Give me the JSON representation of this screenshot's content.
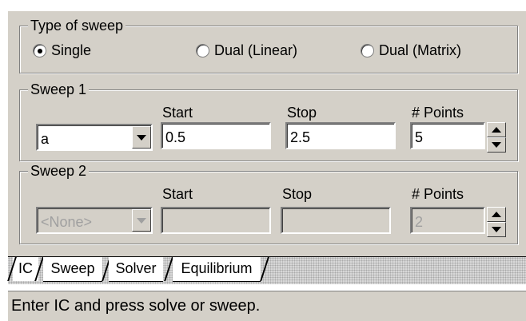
{
  "type_of_sweep": {
    "legend": "Type of sweep",
    "options": [
      {
        "label": "Single",
        "checked": true
      },
      {
        "label": "Dual (Linear)",
        "checked": false
      },
      {
        "label": "Dual (Matrix)",
        "checked": false
      }
    ]
  },
  "sweep1": {
    "legend": "Sweep 1",
    "variable": "a",
    "start_label": "Start",
    "stop_label": "Stop",
    "points_label": "# Points",
    "start": "0.5",
    "stop": "2.5",
    "points": "5"
  },
  "sweep2": {
    "legend": "Sweep 2",
    "variable": "<None>",
    "start_label": "Start",
    "stop_label": "Stop",
    "points_label": "# Points",
    "start": "",
    "stop": "",
    "points": "2"
  },
  "tabs": [
    {
      "label": "IC",
      "active": true
    },
    {
      "label": "Sweep",
      "active": false
    },
    {
      "label": "Solver",
      "active": false
    },
    {
      "label": "Equilibrium",
      "active": false
    }
  ],
  "status": "Enter IC and press solve or sweep."
}
